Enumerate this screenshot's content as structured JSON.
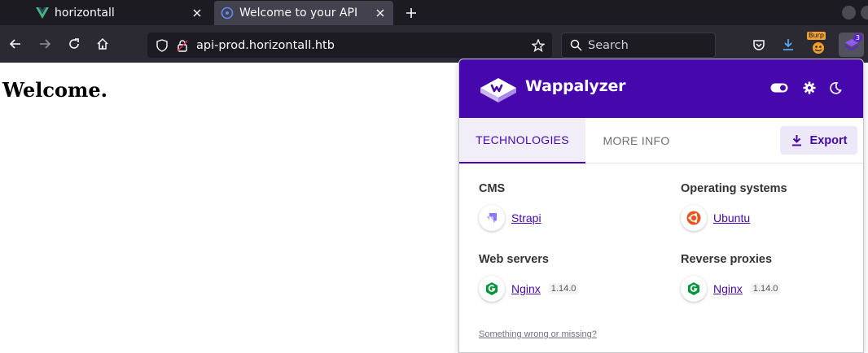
{
  "tabs": [
    {
      "title": "horizontall",
      "favicon": "vue-icon",
      "active": false
    },
    {
      "title": "Welcome to your API",
      "favicon": "strapi-favicon-icon",
      "active": true
    }
  ],
  "navbar": {
    "url": "api-prod.horizontall.htb",
    "search_placeholder": "Search",
    "extensions": [
      {
        "name": "pocket-icon"
      },
      {
        "name": "downloads-icon"
      },
      {
        "name": "burp-icon",
        "label": "Burp"
      },
      {
        "name": "wappalyzer-icon",
        "badge": "3"
      }
    ]
  },
  "page": {
    "heading": "Welcome."
  },
  "wappalyzer": {
    "brand": "Wappalyzer",
    "tabs": {
      "technologies": "TECHNOLOGIES",
      "more_info": "MORE INFO"
    },
    "export_label": "Export",
    "categories": [
      {
        "title": "CMS",
        "tech": {
          "name": "Strapi",
          "version": ""
        }
      },
      {
        "title": "Operating systems",
        "tech": {
          "name": "Ubuntu",
          "version": ""
        }
      },
      {
        "title": "Web servers",
        "tech": {
          "name": "Nginx",
          "version": "1.14.0"
        }
      },
      {
        "title": "Reverse proxies",
        "tech": {
          "name": "Nginx",
          "version": "1.14.0"
        }
      }
    ],
    "footer_link": "Something wrong or missing?"
  },
  "colors": {
    "wappalyzer_purple": "#4608ad",
    "browser_dark": "#1c1b22",
    "toolbar": "#2b2a33"
  }
}
